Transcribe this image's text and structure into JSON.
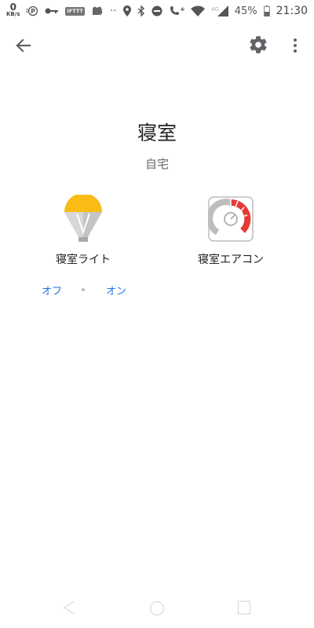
{
  "status_bar": {
    "net_speed_value": "0",
    "net_speed_unit": "KB/s",
    "ifttt_label": "IFTTT",
    "overflow_dots": "··",
    "net_4g_1": "4G",
    "net_4g_2": "4G",
    "battery_percent": "45%",
    "time": "21:30"
  },
  "page": {
    "room_title": "寝室",
    "home_name": "自宅"
  },
  "devices": [
    {
      "name": "寝室ライト",
      "icon": "lightbulb-icon",
      "color": "#F9BC15"
    },
    {
      "name": "寝室エアコン",
      "icon": "thermostat-gauge-icon",
      "color": "#E53935"
    }
  ],
  "light_controls": {
    "off_label": "オフ",
    "on_label": "オン"
  },
  "colors": {
    "accent": "#1a73e8",
    "icon_gray": "#616161"
  }
}
